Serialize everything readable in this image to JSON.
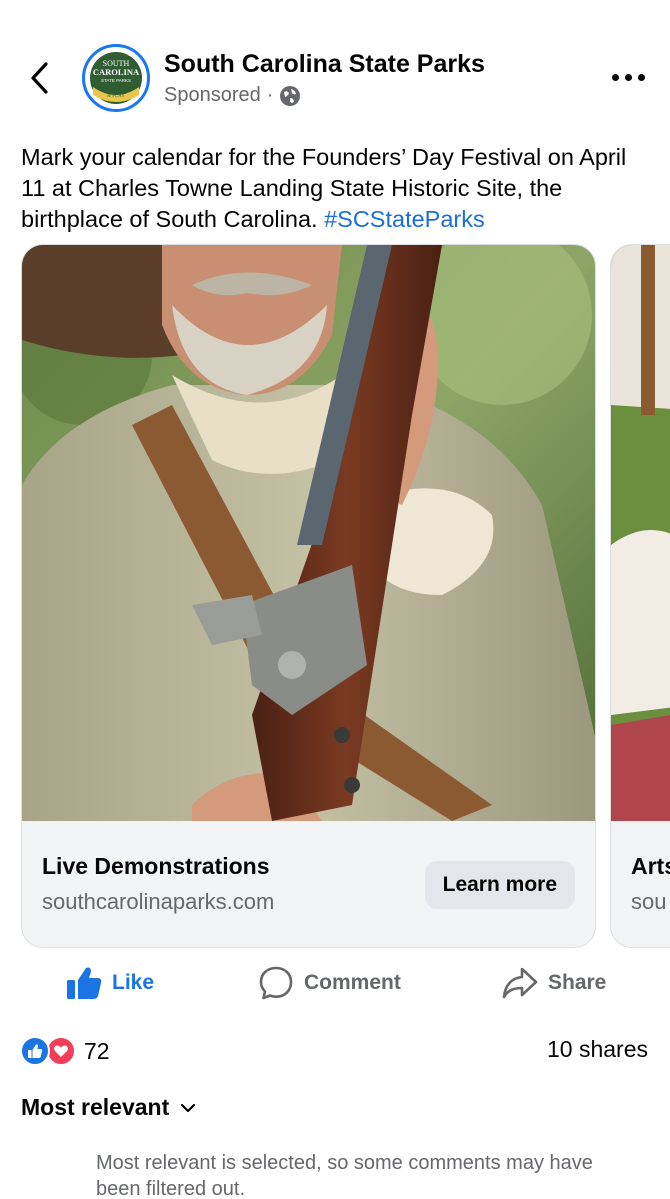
{
  "header": {
    "page_name": "South Carolina State Parks",
    "sponsored_label": "Sponsored",
    "separator": "·",
    "privacy_icon": "globe-icon",
    "logo": {
      "line1": "SOUTH",
      "line2": "CAROLINA",
      "line3": "STATE PARKS",
      "line4": "COME OUT",
      "line5": "& PLAY"
    }
  },
  "caption": {
    "text": "Mark your calendar for the Founders’ Day Festival on April 11 at Charles Towne Landing State Historic Site, the birthplace of South Carolina. ",
    "hashtag": "#SCStateParks"
  },
  "carousel": [
    {
      "title": "Live Demonstrations",
      "domain": "southcarolinaparks.com",
      "cta": "Learn more"
    },
    {
      "title": "Arts",
      "domain": "sou"
    }
  ],
  "actions": {
    "like": "Like",
    "comment": "Comment",
    "share": "Share"
  },
  "stats": {
    "reaction_count": "72",
    "shares": "10 shares"
  },
  "comments": {
    "sort_label": "Most relevant",
    "filter_note": "Most relevant is selected, so some comments may have been filtered out."
  },
  "colors": {
    "accent": "#1b74e4",
    "love": "#f33e58",
    "secondary_text": "#65676b"
  }
}
